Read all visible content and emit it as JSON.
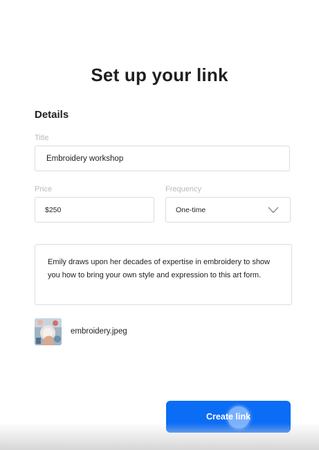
{
  "page": {
    "title": "Set up your link"
  },
  "details": {
    "section_title": "Details",
    "title_label": "Title",
    "title_value": "Embroidery workshop",
    "price_label": "Price",
    "price_value": "$250",
    "frequency_label": "Frequency",
    "frequency_value": "One-time",
    "description": "Emily draws upon her decades of expertise in embroidery to show you how to bring your own style and expression to this art form."
  },
  "attachment": {
    "file_name": "embroidery.jpeg",
    "thumbnail_icon": "image-thumbnail-icon"
  },
  "actions": {
    "create_label": "Create link",
    "accent_color": "#0b6cf5"
  }
}
